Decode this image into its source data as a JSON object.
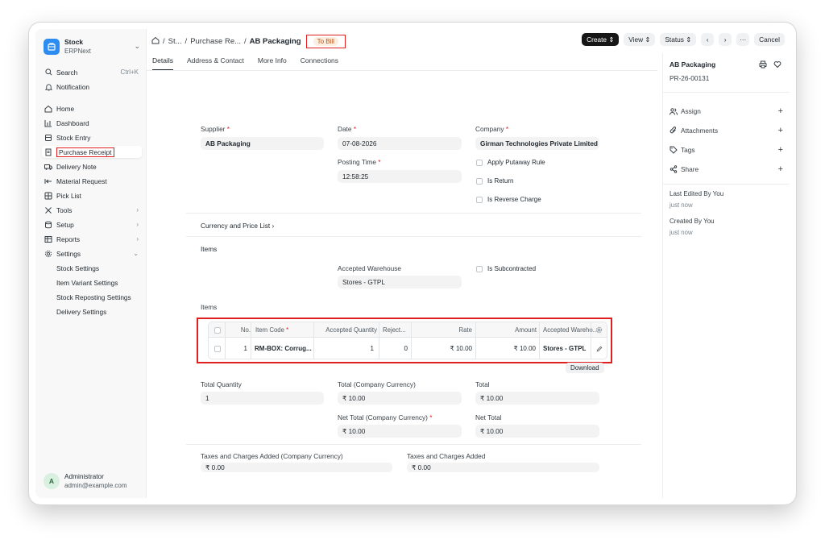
{
  "app": {
    "name": "Stock",
    "subtitle": "ERPNext"
  },
  "sidebar": {
    "search_label": "Search",
    "search_shortcut": "Ctrl+K",
    "notification_label": "Notification",
    "items": [
      {
        "label": "Home"
      },
      {
        "label": "Dashboard"
      },
      {
        "label": "Stock Entry"
      },
      {
        "label": "Purchase Receipt"
      },
      {
        "label": "Delivery Note"
      },
      {
        "label": "Material Request"
      },
      {
        "label": "Pick List"
      },
      {
        "label": "Tools"
      },
      {
        "label": "Setup"
      },
      {
        "label": "Reports"
      },
      {
        "label": "Settings"
      }
    ],
    "settings_children": [
      "Stock Settings",
      "Item Variant Settings",
      "Stock Reposting Settings",
      "Delivery Settings"
    ],
    "user": {
      "initial": "A",
      "name": "Administrator",
      "email": "admin@example.com"
    }
  },
  "breadcrumb": {
    "c1": "St...",
    "c2": "Purchase Re...",
    "current": "AB Packaging",
    "status": "To Bill"
  },
  "actions": {
    "create": "Create",
    "view": "View",
    "status": "Status",
    "cancel": "Cancel"
  },
  "tabs": [
    "Details",
    "Address & Contact",
    "More Info",
    "Connections"
  ],
  "form": {
    "supplier_label": "Supplier",
    "supplier": "AB Packaging",
    "date_label": "Date",
    "date": "07-08-2026",
    "posting_time_label": "Posting Time",
    "posting_time": "12:58:25",
    "company_label": "Company",
    "company": "Girman Technologies Private Limited",
    "apply_putaway": "Apply Putaway Rule",
    "is_return": "Is Return",
    "is_reverse_charge": "Is Reverse Charge",
    "currency_section": "Currency and Price List",
    "items_section": "Items",
    "accepted_warehouse_label": "Accepted Warehouse",
    "accepted_warehouse": "Stores - GTPL",
    "is_subcontracted": "Is Subcontracted",
    "items_table_label": "Items",
    "total_qty_label": "Total Quantity",
    "total_qty": "1",
    "total_cc_label": "Total (Company Currency)",
    "total_cc": "₹ 10.00",
    "total_label": "Total",
    "total": "₹ 10.00",
    "net_total_cc_label": "Net Total (Company Currency)",
    "net_total_cc": "₹ 10.00",
    "net_total_label": "Net Total",
    "net_total": "₹ 10.00",
    "taxes_cc_label": "Taxes and Charges Added (Company Currency)",
    "taxes_cc": "₹ 0.00",
    "taxes_label": "Taxes and Charges Added",
    "taxes": "₹ 0.00",
    "download": "Download"
  },
  "items_table": {
    "headers": [
      "No.",
      "Item Code",
      "Accepted Quantity",
      "Reject...",
      "Rate",
      "Amount",
      "Accepted Wareho..."
    ],
    "rows": [
      {
        "no": "1",
        "item_code": "RM-BOX: Corrug...",
        "accepted_qty": "1",
        "rejected_qty": "0",
        "rate": "₹ 10.00",
        "amount": "₹ 10.00",
        "warehouse": "Stores - GTPL"
      }
    ]
  },
  "right_panel": {
    "title": "AB Packaging",
    "doc_id": "PR-26-00131",
    "assign": "Assign",
    "attachments": "Attachments",
    "tags": "Tags",
    "share": "Share",
    "last_edited_label": "Last Edited By You",
    "last_edited_value": "just now",
    "created_label": "Created By You",
    "created_value": "just now"
  },
  "colors": {
    "accent": "#171717",
    "highlight": "#e02020",
    "status_bg": "#fdeee2",
    "status_text": "#b5541b"
  }
}
